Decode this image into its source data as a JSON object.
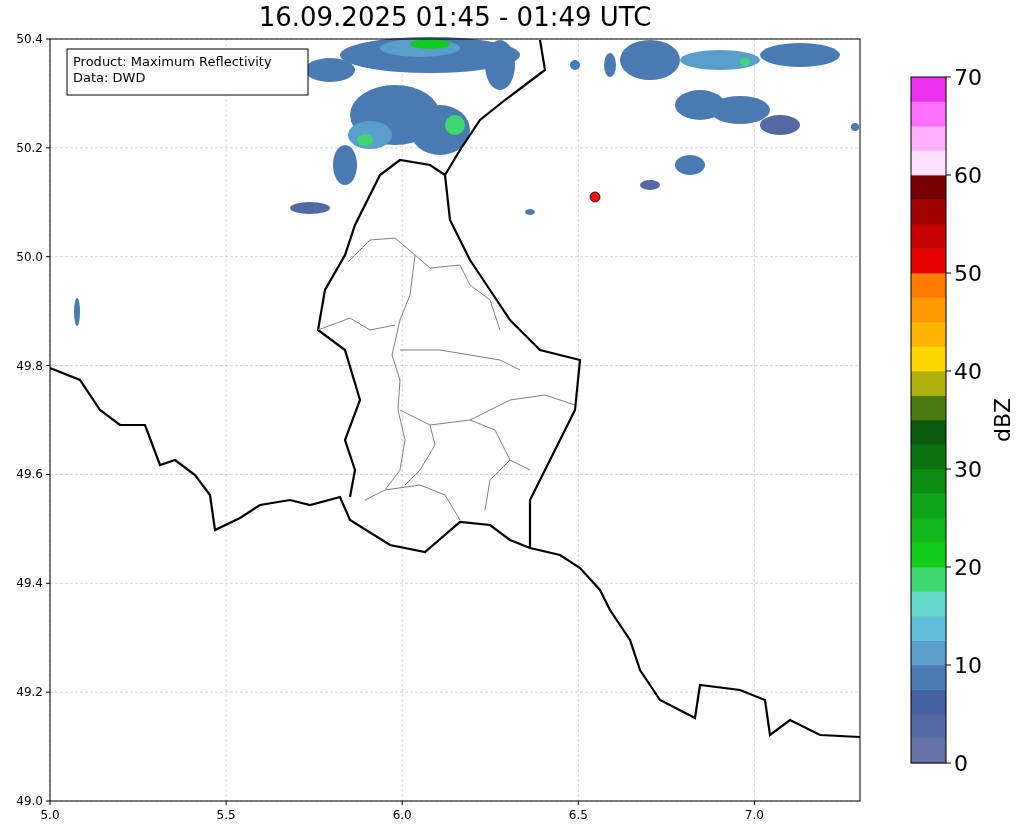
{
  "title": "16.09.2025 01:45 - 01:49 UTC",
  "map": {
    "info_box": [
      "Product: Maximum Reflectivity",
      "Data: DWD"
    ],
    "xticks": [
      "5.0",
      "5.5",
      "6.0",
      "6.5",
      "7.0"
    ],
    "yticks": [
      "50.4",
      "50.2",
      "50.0",
      "49.8",
      "49.6",
      "49.4",
      "49.2",
      "49.0"
    ]
  },
  "colorbar": {
    "label": "dBZ",
    "ticks": [
      "70",
      "60",
      "50",
      "40",
      "30",
      "20",
      "10",
      "0"
    ],
    "bands": [
      {
        "color": "#6473a6"
      },
      {
        "color": "#5468a3"
      },
      {
        "color": "#4360a0"
      },
      {
        "color": "#4a7ab2"
      },
      {
        "color": "#5a9fca"
      },
      {
        "color": "#62bfdb"
      },
      {
        "color": "#63d7c9"
      },
      {
        "color": "#3dd970"
      },
      {
        "color": "#12cc1c"
      },
      {
        "color": "#10b81a"
      },
      {
        "color": "#0fa518"
      },
      {
        "color": "#0d8c14"
      },
      {
        "color": "#0b7212"
      },
      {
        "color": "#09590f"
      },
      {
        "color": "#4a7a10"
      },
      {
        "color": "#afb00a"
      },
      {
        "color": "#ffd700"
      },
      {
        "color": "#ffb400"
      },
      {
        "color": "#ff9b00"
      },
      {
        "color": "#ff7c00"
      },
      {
        "color": "#e60000"
      },
      {
        "color": "#c40000"
      },
      {
        "color": "#a00000"
      },
      {
        "color": "#780000"
      },
      {
        "color": "#ffe0ff"
      },
      {
        "color": "#ffb0ff"
      },
      {
        "color": "#ff70ff"
      },
      {
        "color": "#ee33ee"
      }
    ]
  }
}
